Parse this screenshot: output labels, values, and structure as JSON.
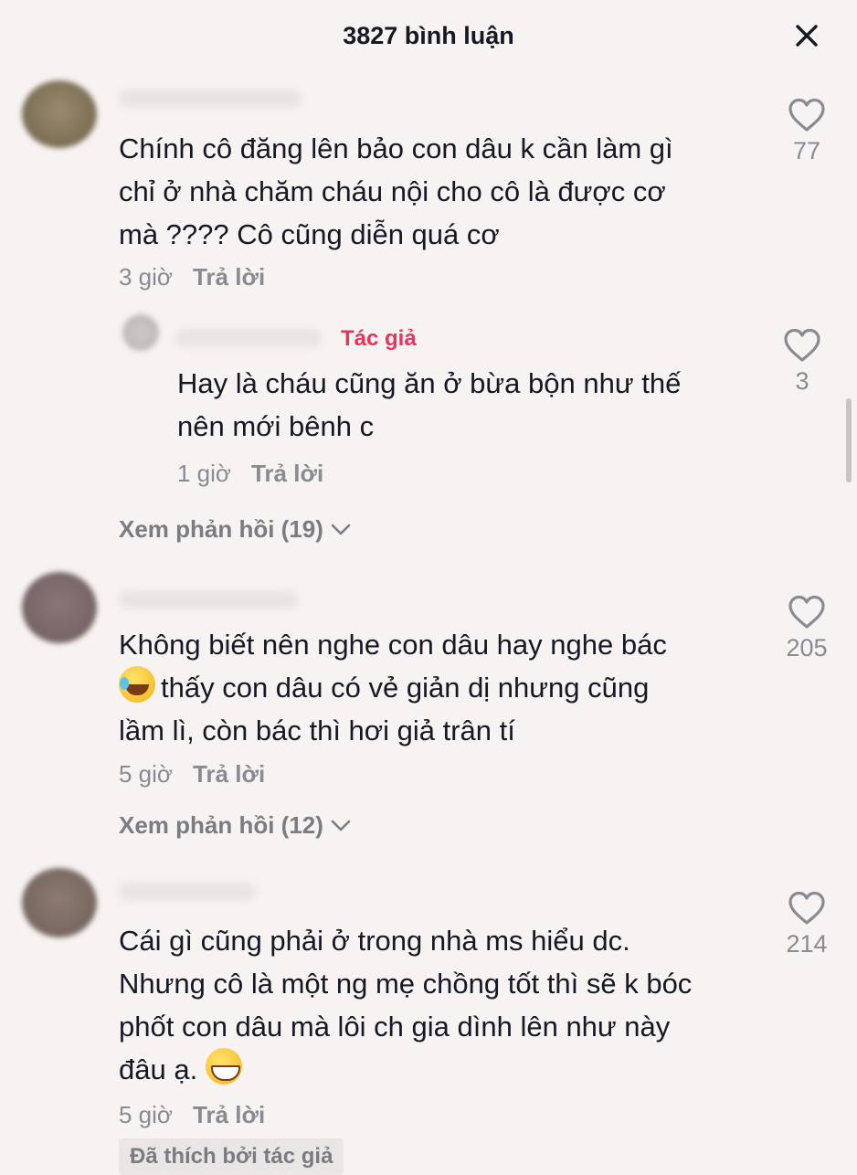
{
  "header": {
    "title": "3827 bình luận"
  },
  "comments": [
    {
      "lines": [
        "Chính cô đăng lên bảo con dâu k cần làm gì",
        "chỉ ở nhà chăm cháu nội cho cô là được cơ",
        "mà ???? Cô cũng diễn quá cơ"
      ],
      "time": "3 giờ",
      "reply_label": "Trả lời",
      "likes": "77",
      "reply": {
        "author_tag": "Tác giả",
        "lines": [
          "Hay là cháu cũng ăn ở bừa bộn như thế",
          "nên mới bênh c"
        ],
        "time": "1 giờ",
        "reply_label": "Trả lời",
        "likes": "3"
      },
      "view_replies": "Xem phản hồi (19)"
    },
    {
      "lines": [
        "Không biết nên nghe con dâu hay nghe bác",
        "thấy con dâu có vẻ giản dị nhưng cũng",
        "lầm lì, còn bác thì hơi giả trân tí"
      ],
      "time": "5 giờ",
      "reply_label": "Trả lời",
      "likes": "205",
      "view_replies": "Xem phản hồi (12)"
    },
    {
      "lines": [
        "Cái gì cũng phải ở trong nhà ms hiểu dc.",
        "Nhưng cô là một ng mẹ chồng tốt thì sẽ k bóc",
        "phốt con dâu mà lôi ch gia dình lên như này",
        "đâu ạ."
      ],
      "time": "5 giờ",
      "reply_label": "Trả lời",
      "likes": "214",
      "badge": "Đã thích bởi tác giả"
    }
  ],
  "icons": {
    "close": "close-icon",
    "like": "heart-outline-icon",
    "chevron": "chevron-down-icon",
    "emoji_1": "face-with-tears-of-joy-emoji",
    "emoji_2": "grinning-face-emoji"
  },
  "colors": {
    "background": "#f7f3f3",
    "author_tag": "#e8345a",
    "meta_text": "#8a8b91"
  }
}
